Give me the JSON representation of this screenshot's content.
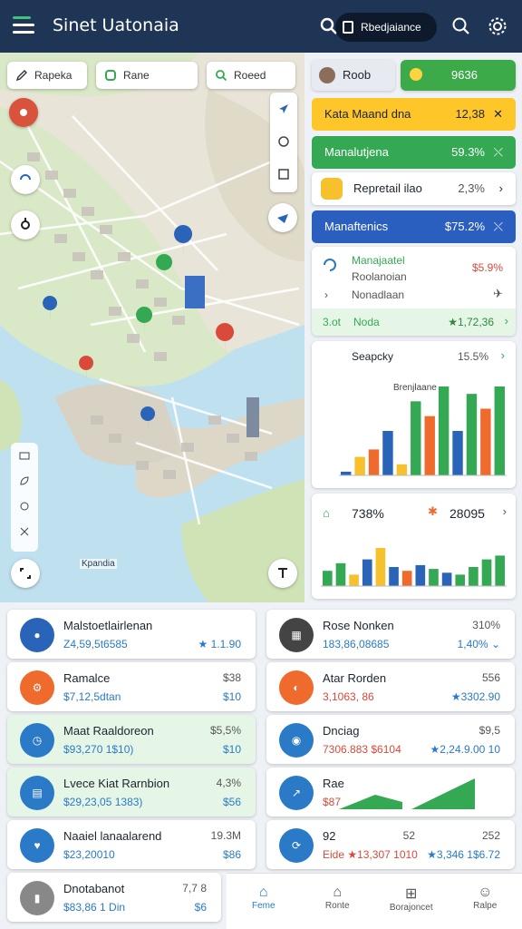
{
  "header": {
    "title": "Sinet Uatonaia",
    "pill_label": "Rbedjaiance"
  },
  "map": {
    "chips": [
      "Rapeka",
      "Rane",
      "Roeed"
    ],
    "labels": [
      "Kpandia"
    ]
  },
  "right": {
    "profile": {
      "name": "Roob",
      "value": "9636"
    },
    "rows": [
      {
        "label": "Kata Maand dna",
        "value": "12,38",
        "arrow": "✕",
        "bg": "#ffc629"
      },
      {
        "label": "Manalutjena",
        "value": "59.3%",
        "arrow": "⤬",
        "bg": "#34a853",
        "fg": "#ffffff"
      },
      {
        "label": "Repretail ilao",
        "value": "2,3%",
        "arrow": "›",
        "bg": "#ffffff"
      },
      {
        "label": "Manaftenics",
        "value": "$75.2%",
        "arrow": "⤬",
        "bg": "#2b5fbf",
        "fg": "#ffffff"
      }
    ],
    "manage_card": {
      "title": "Manajaatel",
      "value": "$5.9%",
      "line2": "Roolanoian",
      "line3": "Nonadlaan",
      "footer_left": "3.ot",
      "footer_mid": "Noda",
      "footer_value": "★1,72,36"
    },
    "chart1": {
      "title": "Seapcky",
      "value": "15.5%",
      "inner_title": "Brenjlaane"
    },
    "chart2": {
      "left_value": "738%",
      "right_value": "28095"
    }
  },
  "chart_data": [
    {
      "type": "bar",
      "title": "Brenjlaane",
      "series": [
        {
          "values": [
            1,
            5,
            7,
            12,
            3,
            20,
            16,
            24,
            12,
            22,
            18,
            24
          ]
        }
      ]
    },
    {
      "type": "bar",
      "series": [
        {
          "values": [
            8,
            12,
            6,
            14,
            20,
            10,
            8,
            11,
            9,
            7,
            6,
            10,
            14,
            16
          ]
        }
      ]
    }
  ],
  "tiles": [
    {
      "t1": "Malstoetlairlenan",
      "t2": "Z4,59,5t6585",
      "r2": "★ 1.1.90",
      "icon": "avatar-icon",
      "color": "#2a64b8",
      "green": false
    },
    {
      "t1": "Rose Nonken",
      "r1": "310%",
      "t2": "183,86,08685",
      "r2": "1,40% ⌄",
      "icon": "photo-icon",
      "color": "#444",
      "green": false
    },
    {
      "t1": "Ramalce",
      "r1": "$38",
      "t2": "$7,12,5dtan",
      "r2": "$10",
      "icon": "settings-icon",
      "color": "#ef6a2d",
      "green": false
    },
    {
      "t1": "Atar Rorden",
      "r1": "556",
      "t2": "3,1063, 86",
      "r2": "★3302.90",
      "icon": "gauge-icon",
      "color": "#ef6a2d",
      "green": false
    },
    {
      "t1": "Maat Raaldoreon",
      "r1": "$5,5%",
      "t2": "$93,270 1$10)",
      "r2": "$10",
      "icon": "clock-icon",
      "color": "#2a7ac8",
      "green": true
    },
    {
      "t1": "Dnciag",
      "r1": "$9,5",
      "t2": "7306.883 $6104",
      "r2": "★2,24.9.00 10",
      "icon": "drop-icon",
      "color": "#2a7ac8",
      "green": false
    },
    {
      "t1": "Lvece Kiat Rarnbion",
      "r1": "4,3%",
      "t2": "$29,23,05 1383)",
      "r2": "$56",
      "icon": "document-icon",
      "color": "#2a7ac8",
      "green": true
    },
    {
      "t1": "Rae",
      "t2": "$87",
      "icon": "trend-icon",
      "color": "#2a7ac8",
      "green": false
    },
    {
      "t1": "Naaiel lanaalarend",
      "r1": "19.3M",
      "t2": "$23,20010",
      "r2": "$86",
      "icon": "heart-icon",
      "color": "#2a7ac8",
      "green": false
    },
    {
      "t1": "92",
      "r1": "252",
      "mid": "52",
      "t2": "Eide ★13,307 1010",
      "r2": "★3,346 1$6.72",
      "icon": "refresh-icon",
      "color": "#2a7ac8",
      "green": false
    },
    {
      "t1": "Dnotabanot",
      "r1": "7,7 8",
      "t2": "$83,86 1 Din",
      "r2": "$6",
      "icon": "battery-icon",
      "color": "#888",
      "green": false
    }
  ],
  "bottom_nav": [
    "Feme",
    "Ronte",
    "Borajoncet",
    "Ralpe"
  ]
}
